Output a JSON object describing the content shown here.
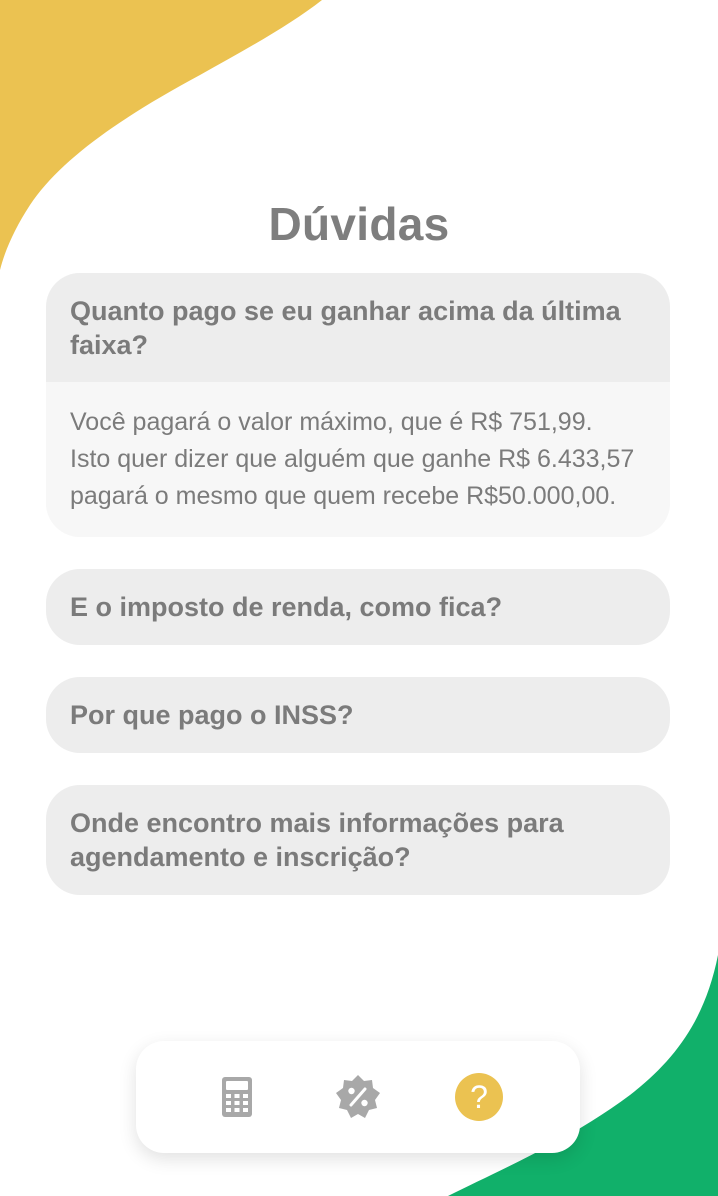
{
  "page": {
    "title": "Dúvidas"
  },
  "colors": {
    "accent_yellow": "#EBC251",
    "accent_green": "#11B06A",
    "text_gray": "#7B7B7B",
    "card_gray": "#EDEDED",
    "answer_bg": "#F7F7F7"
  },
  "faq": [
    {
      "question": "Quanto pago se eu ganhar acima da última faixa?",
      "answer_lines": [
        "Você pagará o valor máximo, que é R$ 751,99.",
        "Isto quer dizer que alguém que ganhe R$ 6.433,57",
        "pagará o mesmo que quem recebe R$50.000,00."
      ],
      "expanded": true
    },
    {
      "question": "E o imposto de renda, como fica?",
      "expanded": false
    },
    {
      "question": "Por que pago o INSS?",
      "expanded": false
    },
    {
      "question": "Onde encontro mais informações para agendamento e inscrição?",
      "expanded": false
    }
  ],
  "bottom_nav": {
    "items": [
      {
        "icon": "calculator-icon",
        "active": false
      },
      {
        "icon": "discount-badge-icon",
        "active": false
      },
      {
        "icon": "help-icon",
        "glyph": "?",
        "active": true
      }
    ]
  }
}
